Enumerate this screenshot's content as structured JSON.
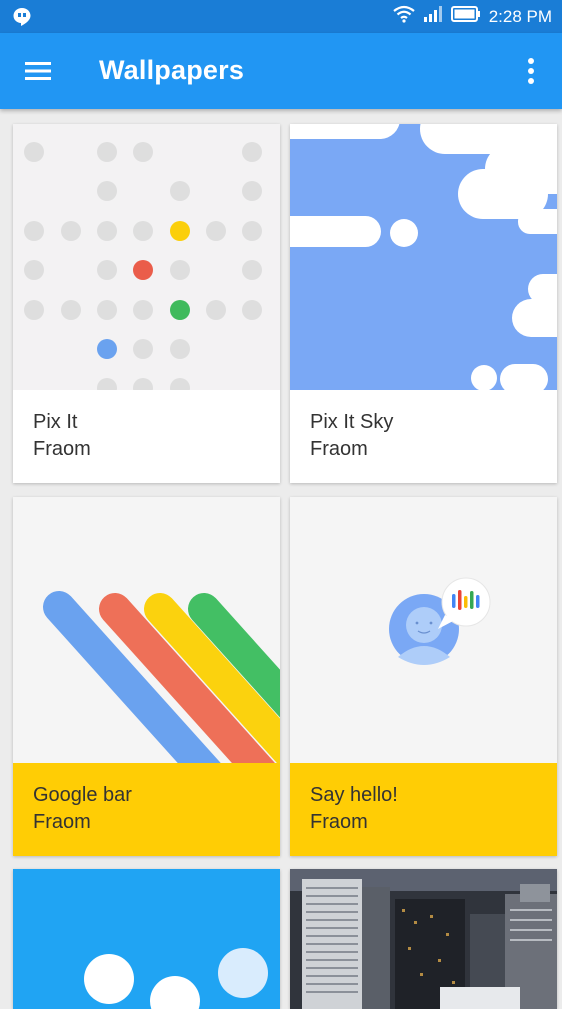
{
  "status_bar": {
    "time": "2:28 PM",
    "icons": [
      "hangouts-icon",
      "wifi-icon",
      "signal-icon",
      "battery-icon"
    ]
  },
  "app_bar": {
    "title": "Wallpapers",
    "left_icon": "hamburger-menu-icon",
    "right_icon": "more-vert-icon",
    "color": "#2196f3"
  },
  "cards": [
    {
      "title": "Pix It",
      "author": "Fraom",
      "caption_color": "#ffffff"
    },
    {
      "title": "Pix It Sky",
      "author": "Fraom",
      "caption_color": "#ffffff"
    },
    {
      "title": "Google bar",
      "author": "Fraom",
      "caption_color": "#ffcd05"
    },
    {
      "title": "Say hello!",
      "author": "Fraom",
      "caption_color": "#ffcd05"
    },
    {
      "title": "",
      "author": "",
      "caption_color": "#ffffff"
    },
    {
      "title": "",
      "author": "",
      "caption_color": "#ffffff"
    }
  ],
  "colors": {
    "blue": "#4285f4",
    "red": "#ea4335",
    "yellow": "#fbbc05",
    "green": "#34a853"
  }
}
